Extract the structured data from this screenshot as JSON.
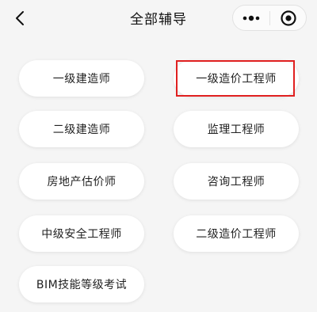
{
  "navbar": {
    "title": "全部辅导",
    "back_icon": "chevron-left-icon",
    "more_icon": "more-dots-icon",
    "close_icon": "target-close-icon"
  },
  "courses": [
    {
      "label": "一级建造师"
    },
    {
      "label": "一级造价工程师"
    },
    {
      "label": "二级建造师"
    },
    {
      "label": "监理工程师"
    },
    {
      "label": "房地产估价师"
    },
    {
      "label": "咨询工程师"
    },
    {
      "label": "中级安全工程师"
    },
    {
      "label": "二级造价工程师"
    },
    {
      "label": "BIM技能等级考试"
    }
  ],
  "colors": {
    "highlight": "#e02020",
    "background": "#f5f5f5"
  }
}
